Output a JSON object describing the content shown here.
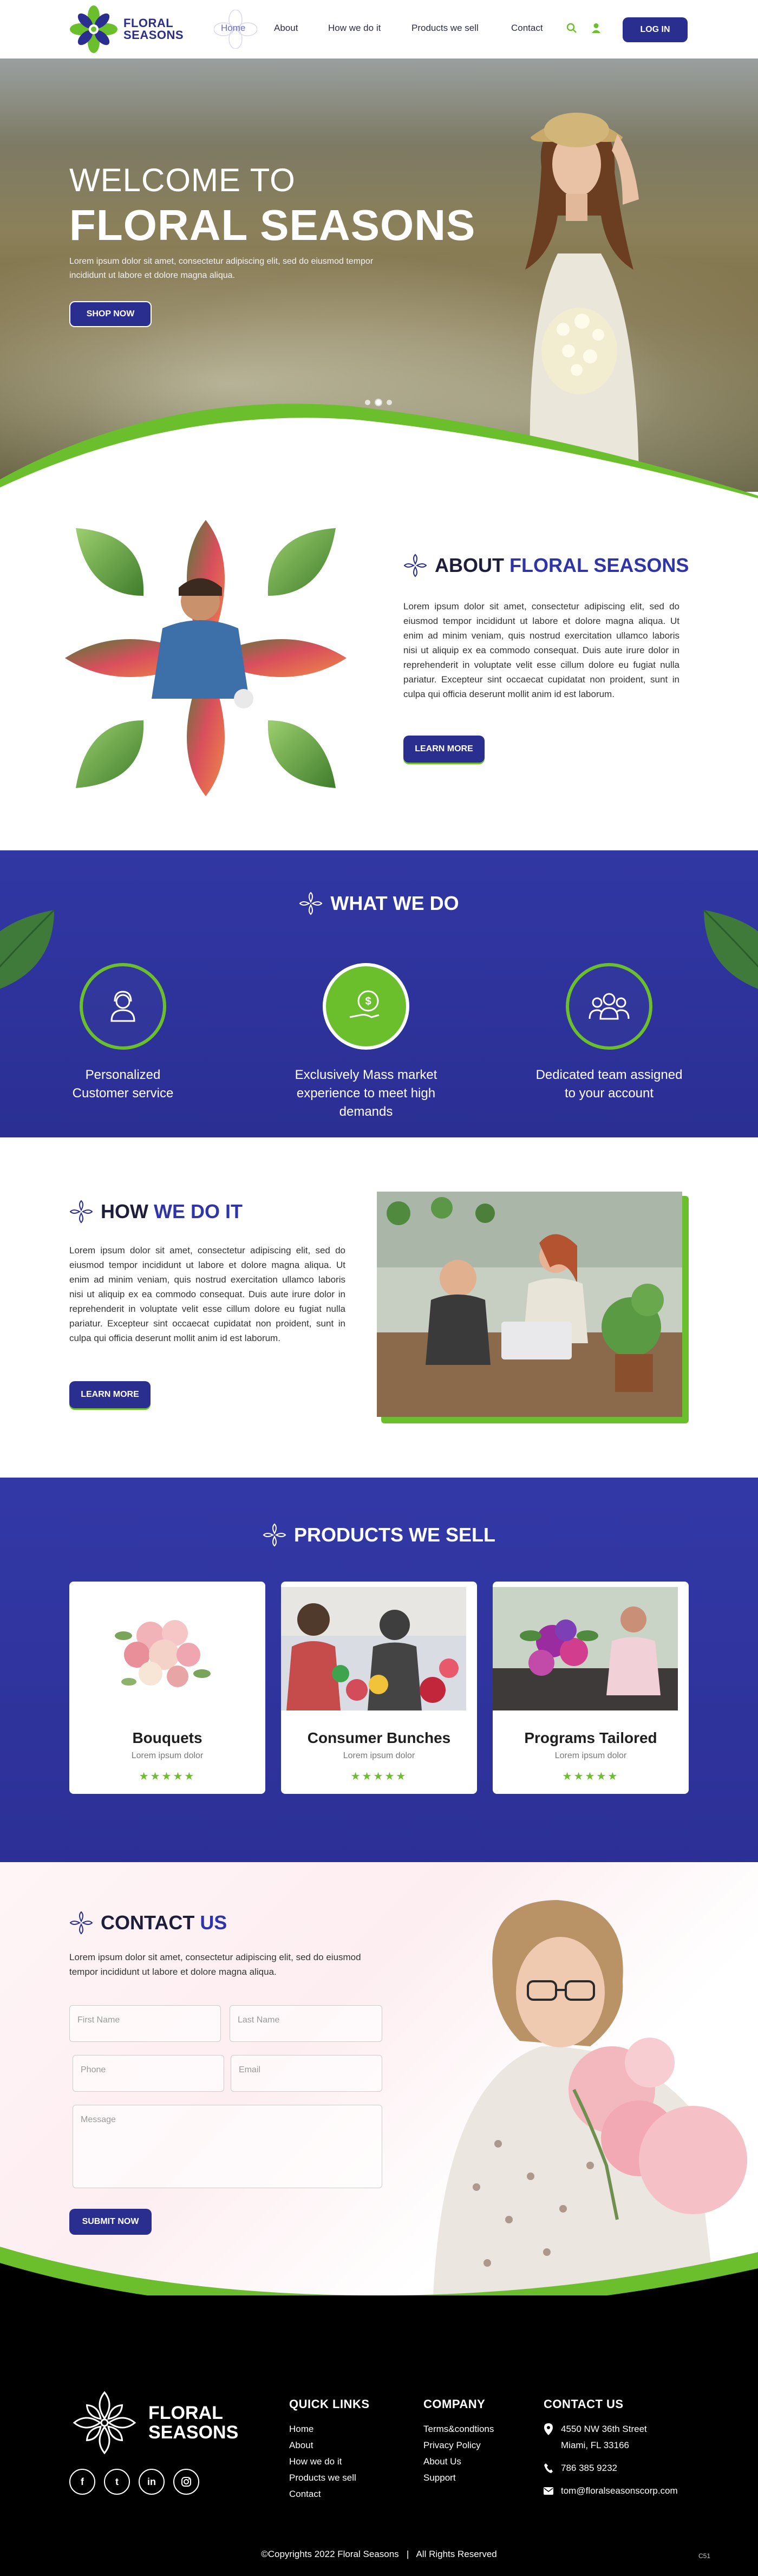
{
  "brand": {
    "name_line1": "FLORAL",
    "name_line2": "SEASONS"
  },
  "nav": {
    "links": [
      "Home",
      "About",
      "How we do it",
      "Products we sell",
      "Contact"
    ],
    "login": "LOG IN"
  },
  "hero": {
    "welcome": "WELCOME TO",
    "title": "FLORAL SEASONS",
    "text": "Lorem ipsum dolor sit amet, consectetur adipiscing elit, sed do eiusmod tempor incididunt ut labore et dolore magna aliqua.",
    "button": "SHOP NOW"
  },
  "about": {
    "heading_a": "ABOUT ",
    "heading_b": "FLORAL SEASONS",
    "text": "Lorem ipsum dolor sit amet, consectetur adipiscing elit, sed do eiusmod tempor incididunt ut labore et dolore magna aliqua. Ut enim ad minim veniam, quis nostrud exercitation ullamco laboris nisi ut aliquip ex ea commodo consequat. Duis aute irure dolor in reprehenderit in voluptate velit esse cillum dolore eu fugiat nulla pariatur. Excepteur sint occaecat cupidatat non proident, sunt in culpa qui officia deserunt mollit anim id est laborum.",
    "button": "LEARN MORE"
  },
  "what_we_do": {
    "heading": "WHAT WE DO",
    "services": [
      {
        "line1": "Personalized",
        "line2": "Customer service"
      },
      {
        "line1": "Exclusively Mass market",
        "line2": "experience to meet high demands"
      },
      {
        "line1": "Dedicated team assigned",
        "line2": "to your account"
      }
    ]
  },
  "how": {
    "heading_a": "HOW ",
    "heading_b": "WE DO IT",
    "text": "Lorem ipsum dolor sit amet, consectetur adipiscing elit, sed do eiusmod tempor incididunt ut labore et dolore magna aliqua. Ut enim ad minim veniam, quis nostrud exercitation ullamco laboris nisi ut aliquip ex ea commodo consequat. Duis aute irure dolor in reprehenderit in voluptate velit esse cillum dolore eu fugiat nulla pariatur. Excepteur sint occaecat cupidatat non proident, sunt in culpa qui officia deserunt mollit anim id est laborum.",
    "button": "LEARN MORE"
  },
  "products": {
    "heading": "PRODUCTS WE SELL",
    "items": [
      {
        "title": "Bouquets",
        "sub": "Lorem ipsum dolor",
        "stars": "★★★★★"
      },
      {
        "title": "Consumer Bunches",
        "sub": "Lorem ipsum dolor",
        "stars": "★★★★★"
      },
      {
        "title": "Programs Tailored",
        "sub": "Lorem ipsum dolor",
        "stars": "★★★★★"
      }
    ]
  },
  "contact": {
    "heading_a": "CONTACT ",
    "heading_b": "US",
    "text": "Lorem ipsum dolor sit amet, consectetur adipiscing elit, sed do eiusmod tempor incididunt ut labore et dolore magna aliqua.",
    "placeholders": {
      "first": "First Name",
      "last": "Last Name",
      "phone": "Phone",
      "email": "Email",
      "message": "Message"
    },
    "button": "SUBMIT NOW"
  },
  "footer": {
    "socials": [
      "f",
      "t",
      "in",
      "ig"
    ],
    "quick_links": {
      "title": "QUICK LINKS",
      "items": [
        "Home",
        "About",
        "How we do it",
        "Products we sell",
        "Contact"
      ]
    },
    "company": {
      "title": "COMPANY",
      "items": [
        "Terms&condtions",
        "Privacy Policy",
        "About Us",
        "Support"
      ]
    },
    "contact": {
      "title": "CONTACT US",
      "address1": "4550 NW 36th Street",
      "address2": "Miami, FL 33166",
      "phone": "786 385 9232",
      "email": "tom@floralseasonscorp.com"
    },
    "copyright": "©Copyrights 2022 Floral Seasons   |   All Rights Reserved",
    "tag": "C51"
  },
  "colors": {
    "navy": "#2a2e8f",
    "green": "#6cbf2c",
    "purple_bg": "#3137a3"
  }
}
